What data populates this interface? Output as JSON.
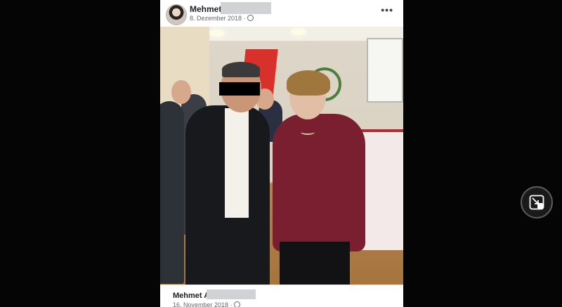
{
  "posts": [
    {
      "author": "Mehmet",
      "date": "8. Dezember 2018 ·"
    },
    {
      "author": "Mehmet A",
      "date": "16. November 2018 ·"
    }
  ],
  "icons": {
    "avatar": "avatar",
    "more": "more-options-icon",
    "privacy": "globe-icon",
    "fullscreen": "exit-fullscreen-icon"
  },
  "more_label": "•••",
  "colors": {
    "background": "#050505",
    "card": "#ffffff",
    "redaction": "#d0d2d5"
  }
}
